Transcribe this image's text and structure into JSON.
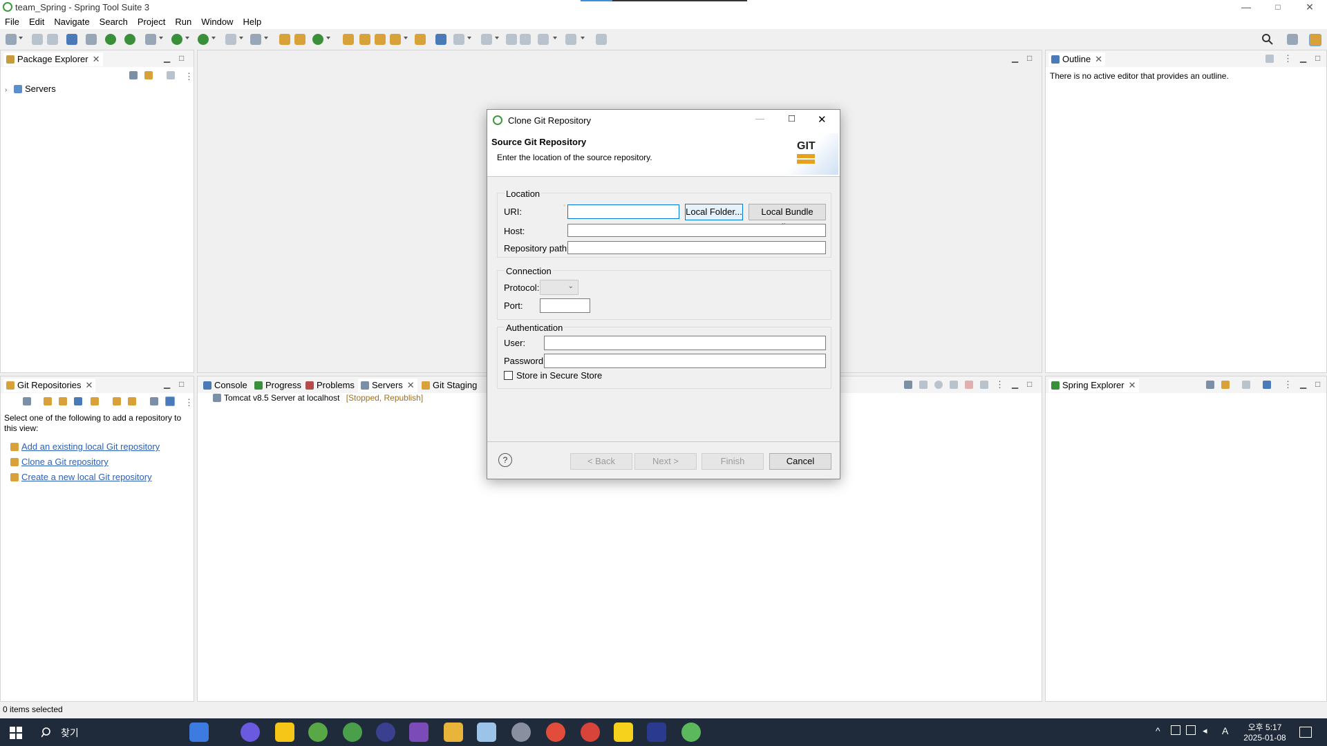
{
  "window": {
    "title": "team_Spring - Spring Tool Suite 3",
    "controls": {
      "minimize": "—",
      "maximize": "□",
      "close": "✕"
    }
  },
  "menu": [
    "File",
    "Edit",
    "Navigate",
    "Search",
    "Project",
    "Run",
    "Window",
    "Help"
  ],
  "package_explorer": {
    "tab_label": "Package Explorer",
    "items": [
      {
        "label": "Servers",
        "icon": "folder-icon"
      }
    ]
  },
  "outline": {
    "tab_label": "Outline",
    "message": "There is no active editor that provides an outline."
  },
  "git_repositories": {
    "tab_label": "Git Repositories",
    "intro": "Select one of the following to add a repository to this view:",
    "links": [
      "Add an existing local Git repository",
      "Clone a Git repository",
      "Create a new local Git repository"
    ]
  },
  "bottom_tabs": {
    "tabs": [
      "Console",
      "Progress",
      "Problems",
      "Servers",
      "Git Staging"
    ],
    "server_entry": "Tomcat v8.5 Server at localhost",
    "server_status": "[Stopped, Republish]"
  },
  "spring_explorer": {
    "tab_label": "Spring Explorer"
  },
  "status_bar": {
    "text": "0 items selected"
  },
  "dialog": {
    "title": "Clone Git Repository",
    "heading": "Source Git Repository",
    "description": "Enter the location of the source repository.",
    "git_logo": "GIT",
    "location_group": "Location",
    "uri_label": "URI:",
    "uri_value": "",
    "local_folder_button": "Local Folder...",
    "local_bundle_button": "Local Bundle File...",
    "host_label": "Host:",
    "host_value": "",
    "repo_path_label": "Repository path:",
    "repo_path_value": "",
    "connection_group": "Connection",
    "protocol_label": "Protocol:",
    "protocol_value": "",
    "port_label": "Port:",
    "port_value": "",
    "auth_group": "Authentication",
    "user_label": "User:",
    "user_value": "",
    "password_label": "Password:",
    "password_value": "",
    "secure_store_label": "Store in Secure Store",
    "secure_store_checked": false,
    "back_button": "< Back",
    "next_button": "Next >",
    "finish_button": "Finish",
    "cancel_button": "Cancel"
  },
  "taskbar": {
    "search_label": "찾기",
    "clock_time": "오후 5:17",
    "clock_date": "2025-01-08",
    "ime": "A"
  }
}
